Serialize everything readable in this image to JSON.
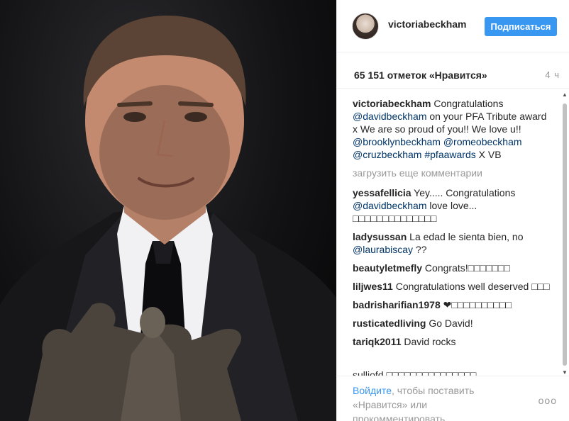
{
  "post": {
    "username": "victoriabeckham",
    "follow_label": "Подписаться",
    "likes": "65 151 отметок «Нравится»",
    "time": "4 ч"
  },
  "caption": {
    "user": "victoriabeckham",
    "t1": " Congratulations ",
    "m1": "@davidbeckham",
    "t2": " on your PFA Tribute award x We are so proud of you!! We love u!! ",
    "m2": "@brooklynbeckham",
    "t3": " ",
    "m3": "@romeobeckham",
    "t4": " ",
    "m4": "@cruzbeckham",
    "t5": " ",
    "m5": "#pfaawards",
    "t6": " X VB"
  },
  "load_more": "загрузить еще комментарии",
  "comments": [
    {
      "user": "yessafellicia",
      "t1": " Yey..... Congratulations ",
      "m1": "@davidbeckham",
      "t2": " love love... □□□□□□□□□□□□□□"
    },
    {
      "user": "ladysussan",
      "t1": " La edad le sienta bien, no ",
      "m1": "@laurabiscay",
      "t2": " ??"
    },
    {
      "user": "beautyletmefly",
      "t1": " Congrats!□□□□□□□"
    },
    {
      "user": "liljwes11",
      "t1": " Congratulations well deserved □□□"
    },
    {
      "user": "badrisharifian1978",
      "t1": " ❤□□□□□□□□□□"
    },
    {
      "user": "rusticatedliving",
      "t1": " Go David!"
    },
    {
      "user": "tariqk2011",
      "t1": " David rocks"
    }
  ],
  "partial_comment": "sulliofd □□□□□□□□□□□□□□□",
  "footer": {
    "login_link": "Войдите",
    "login_rest": ", чтобы поставить «Нравится» или прокомментировать.",
    "more": "ooo"
  },
  "icons": {
    "more": "more-options-icon"
  },
  "colors": {
    "accent": "#3897f0",
    "mention": "#003569",
    "muted": "#999999"
  }
}
